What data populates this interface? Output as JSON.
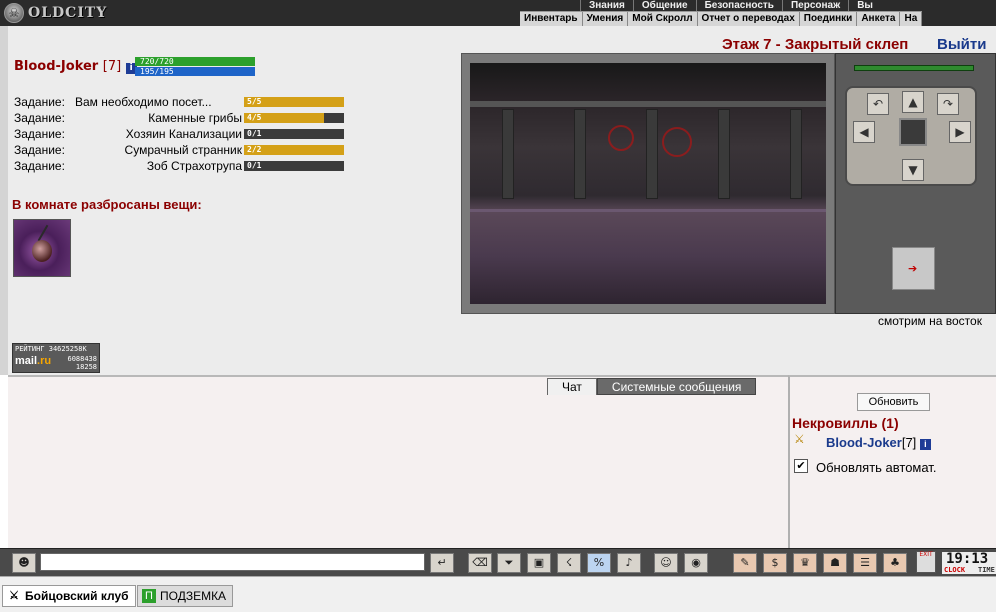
{
  "header": {
    "logo_text": "OLDCITY",
    "top_menu": [
      "Знания",
      "Общение",
      "Безопасность",
      "Персонаж",
      "Вы"
    ],
    "sub_menu": [
      "Инвентарь",
      "Умения",
      "Мой Скролл",
      "Отчет о переводах",
      "Поединки",
      "Анкета",
      "На"
    ]
  },
  "hero": {
    "name": "Blood-Joker",
    "level": "[7]",
    "hp": "720/720",
    "hp_fraction": 1.0,
    "mana": "195/195",
    "mana_fraction": 1.0
  },
  "tasks": [
    {
      "label": "Задание:",
      "name": "Вам необходимо посет...",
      "progress": "5/5",
      "fraction": 1.0
    },
    {
      "label": "Задание:",
      "name": "Каменные грибы",
      "progress": "4/5",
      "fraction": 0.8
    },
    {
      "label": "Задание:",
      "name": "Хозяин Канализации",
      "progress": "0/1",
      "fraction": 0.0
    },
    {
      "label": "Задание:",
      "name": "Сумрачный странник",
      "progress": "2/2",
      "fraction": 1.0
    },
    {
      "label": "Задание:",
      "name": "Зоб Страхотрупа",
      "progress": "0/1",
      "fraction": 0.0
    }
  ],
  "room": {
    "items_title": "В комнате разбросаны вещи:",
    "floor_title": "Этаж 7 - Закрытый склеп",
    "exit_label": "Выйти",
    "direction_text": "смотрим на восток"
  },
  "rating": {
    "label": "РЕЙТИНГ",
    "value1": "34625258K",
    "brand": "mail",
    "brand_suffix": ".ru",
    "value2": "6088438",
    "value3": "18258"
  },
  "chat": {
    "tab_chat": "Чат",
    "tab_system": "Системные сообщения"
  },
  "online": {
    "refresh_label": "Обновить",
    "location": "Некровилль (1)",
    "user_name": "Blood-Joker",
    "user_level": "[7]",
    "auto_label": "Обновлять автомат.",
    "auto_checked": true
  },
  "toolbar": {
    "clock_time": "19:13",
    "clock_label": "CLOCK",
    "time_label": "TIME",
    "exit_label": "EXIT"
  },
  "taskbar": {
    "tab1": "Бойцовский клуб",
    "tab2": "ПОДЗЕМКА"
  },
  "colors": {
    "hero_name": "#8b0000",
    "hp_bar": "#2ca02c",
    "mana_bar": "#1e64c8",
    "task_fill": "#d4a017",
    "link_blue": "#1a3a8c"
  }
}
